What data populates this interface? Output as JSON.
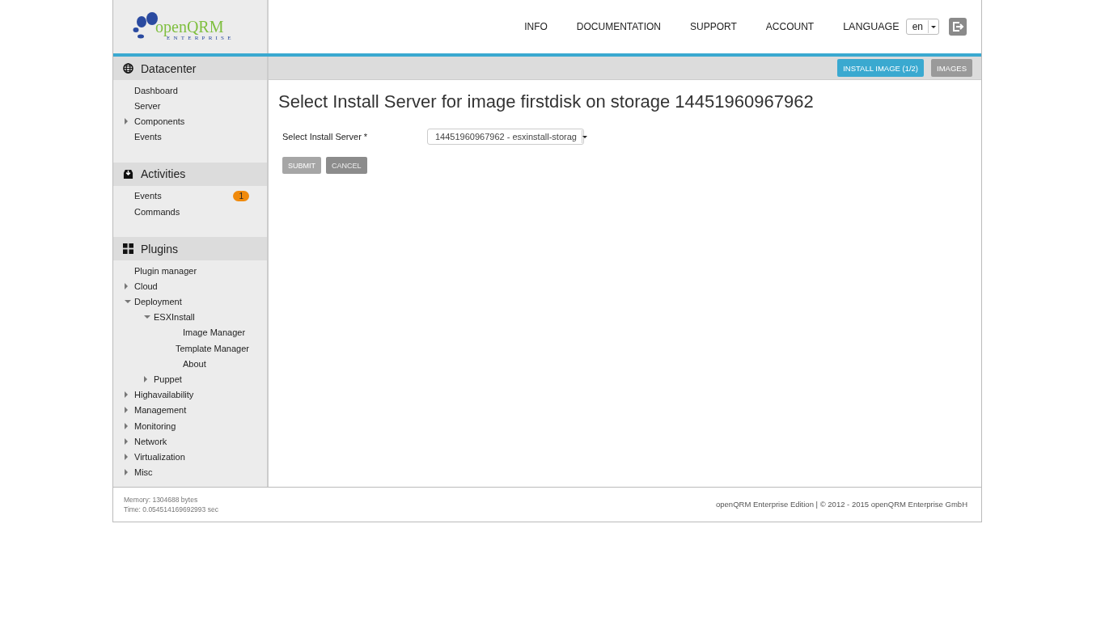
{
  "logo": {
    "name": "openQRM",
    "tagline": "ENTERPRISE"
  },
  "top_nav": [
    "INFO",
    "DOCUMENTATION",
    "SUPPORT",
    "ACCOUNT"
  ],
  "language": {
    "label": "LANGUAGE",
    "value": "en"
  },
  "action_buttons": [
    {
      "label": "INSTALL IMAGE (1/2)",
      "selected": true
    },
    {
      "label": "IMAGES",
      "selected": false
    }
  ],
  "sidebar": [
    {
      "title": "Datacenter",
      "items": [
        {
          "label": "Dashboard"
        },
        {
          "label": "Server"
        },
        {
          "label": "Components",
          "expanded": false
        },
        {
          "label": "Events"
        }
      ]
    },
    {
      "title": "Activities",
      "items": [
        {
          "label": "Events",
          "badge": "1"
        },
        {
          "label": "Commands"
        }
      ]
    },
    {
      "title": "Plugins",
      "items": [
        {
          "label": "Plugin manager"
        },
        {
          "label": "Cloud",
          "expanded": false
        },
        {
          "label": "Deployment",
          "expanded": true,
          "children": [
            {
              "label": "ESXInstall",
              "expanded": true,
              "children": [
                {
                  "label": "Image Manager"
                },
                {
                  "label": "Template Manager"
                },
                {
                  "label": "About"
                }
              ]
            },
            {
              "label": "Puppet",
              "expanded": false
            }
          ]
        },
        {
          "label": "Highavailability",
          "expanded": false
        },
        {
          "label": "Management",
          "expanded": false
        },
        {
          "label": "Monitoring",
          "expanded": false
        },
        {
          "label": "Network",
          "expanded": false
        },
        {
          "label": "Virtualization",
          "expanded": false
        },
        {
          "label": "Misc",
          "expanded": false
        }
      ]
    }
  ],
  "page_title": "Select Install Server for image firstdisk on storage 14451960967962",
  "form": {
    "label": "Select Install Server *",
    "value": "14451960967962 - esxinstall-storag"
  },
  "form_buttons": [
    {
      "label": "SUBMIT",
      "disabled": true
    },
    {
      "label": "CANCEL",
      "disabled": false
    }
  ],
  "footer": {
    "memory": "Memory: 1304688 bytes",
    "time": "Time: 0.054514169692993 sec",
    "copyright": "openQRM Enterprise Edition | © 2012 - 2015 openQRM Enterprise GmbH"
  }
}
